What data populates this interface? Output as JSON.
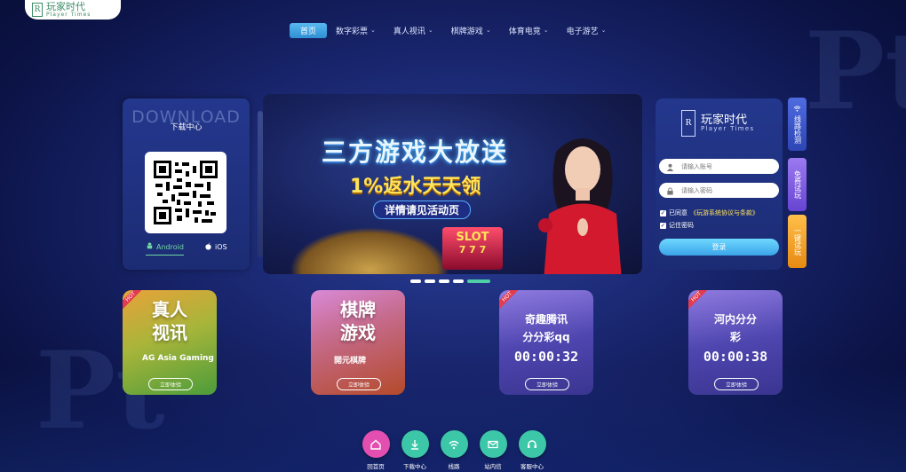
{
  "logo": {
    "name": "玩家时代",
    "sub": "Player Times",
    "mark": "R"
  },
  "nav": [
    {
      "label": "首页",
      "active": true
    },
    {
      "label": "数字彩票",
      "dropdown": true
    },
    {
      "label": "真人视讯",
      "dropdown": true
    },
    {
      "label": "棋牌游戏",
      "dropdown": true
    },
    {
      "label": "体育电竞",
      "dropdown": true
    },
    {
      "label": "电子游艺",
      "dropdown": true
    }
  ],
  "download": {
    "bg_text": "DOWNLOAD",
    "title": "下载中心",
    "android": "Android",
    "ios": "iOS"
  },
  "banner": {
    "headline": "三方游戏大放送",
    "subline": "1%返水天天领",
    "pill": "详情请见活动页",
    "slot": "SLOT"
  },
  "carousel": {
    "count": 5,
    "active_index": 4
  },
  "login": {
    "brand": "玩家时代",
    "brand_sub": "Player Times",
    "mark": "R",
    "username_placeholder": "请输入账号",
    "password_placeholder": "请输入密码",
    "agree_prefix": "已同意",
    "agree_link": "《玩游系统协议与条款》",
    "remember": "记住密码",
    "button": "登录"
  },
  "side_tabs": [
    {
      "label": "线路检测",
      "color": "#3c57c9"
    },
    {
      "label": "免费试玩",
      "color": "#7a55e0"
    },
    {
      "label": "一键试玩",
      "color": "#f0a12a"
    }
  ],
  "tiles": [
    {
      "title_line1": "真人",
      "title_line2": "视讯",
      "hot": "HOT",
      "brand": "AG Asia Gaming",
      "play": "立即体验"
    },
    {
      "title_line1": "棋牌",
      "title_line2": "游戏",
      "brand": "開元棋牌",
      "play": "立即体验"
    },
    {
      "title_line1": "奇趣腾讯",
      "title_line2": "分分彩qq",
      "timer": "00:00:32",
      "hot": "HOT",
      "play": "立即体验"
    },
    {
      "title_line1": "河内分分",
      "title_line2": "彩",
      "timer": "00:00:38",
      "hot": "HOT",
      "play": "立即体验"
    }
  ],
  "bottom_nav": [
    {
      "label": "回首页",
      "icon": "home-icon",
      "color": "#e24fb0"
    },
    {
      "label": "下载中心",
      "icon": "download-icon",
      "color": "#3cc7a8"
    },
    {
      "label": "线路",
      "icon": "wifi-icon",
      "color": "#3cc7a8"
    },
    {
      "label": "站内信",
      "icon": "mail-icon",
      "color": "#3cc7a8"
    },
    {
      "label": "客服中心",
      "icon": "headset-icon",
      "color": "#3cc7a8"
    }
  ],
  "watermark": "Pt"
}
